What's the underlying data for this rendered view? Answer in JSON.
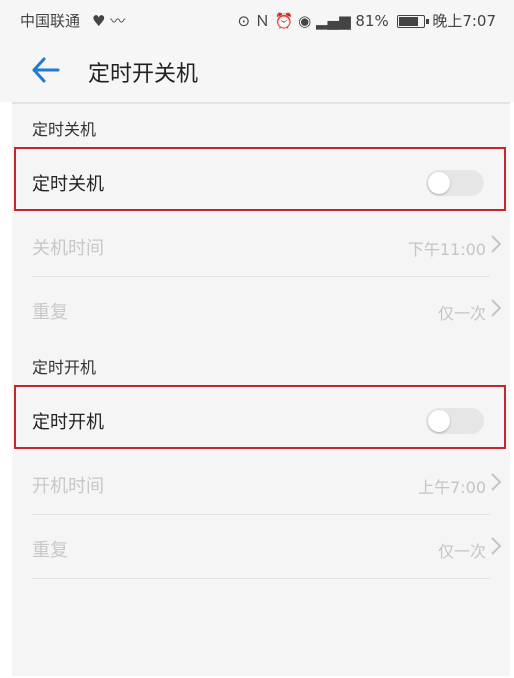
{
  "status_bar": {
    "carrier": "中国联通",
    "battery_percent": "81%",
    "time": "晚上7:07",
    "battery_level": 0.81,
    "icons": [
      "heart-icon",
      "activity-icon",
      "headset-icon",
      "nfc-icon",
      "alarm-icon",
      "eye-icon",
      "signal-icon",
      "battery-icon"
    ]
  },
  "header": {
    "title": "定时开关机"
  },
  "shutdown": {
    "section_title": "定时关机",
    "toggle_label": "定时关机",
    "toggle_on": false,
    "time_label": "关机时间",
    "time_value": "下午11:00",
    "repeat_label": "重复",
    "repeat_value": "仅一次"
  },
  "poweron": {
    "section_title": "定时开机",
    "toggle_label": "定时开机",
    "toggle_on": false,
    "time_label": "开机时间",
    "time_value": "上午7:00",
    "repeat_label": "重复",
    "repeat_value": "仅一次"
  },
  "colors": {
    "accent": "#1e7bd0",
    "highlight_border": "#c0282d",
    "disabled_text": "#c8c8c8"
  }
}
